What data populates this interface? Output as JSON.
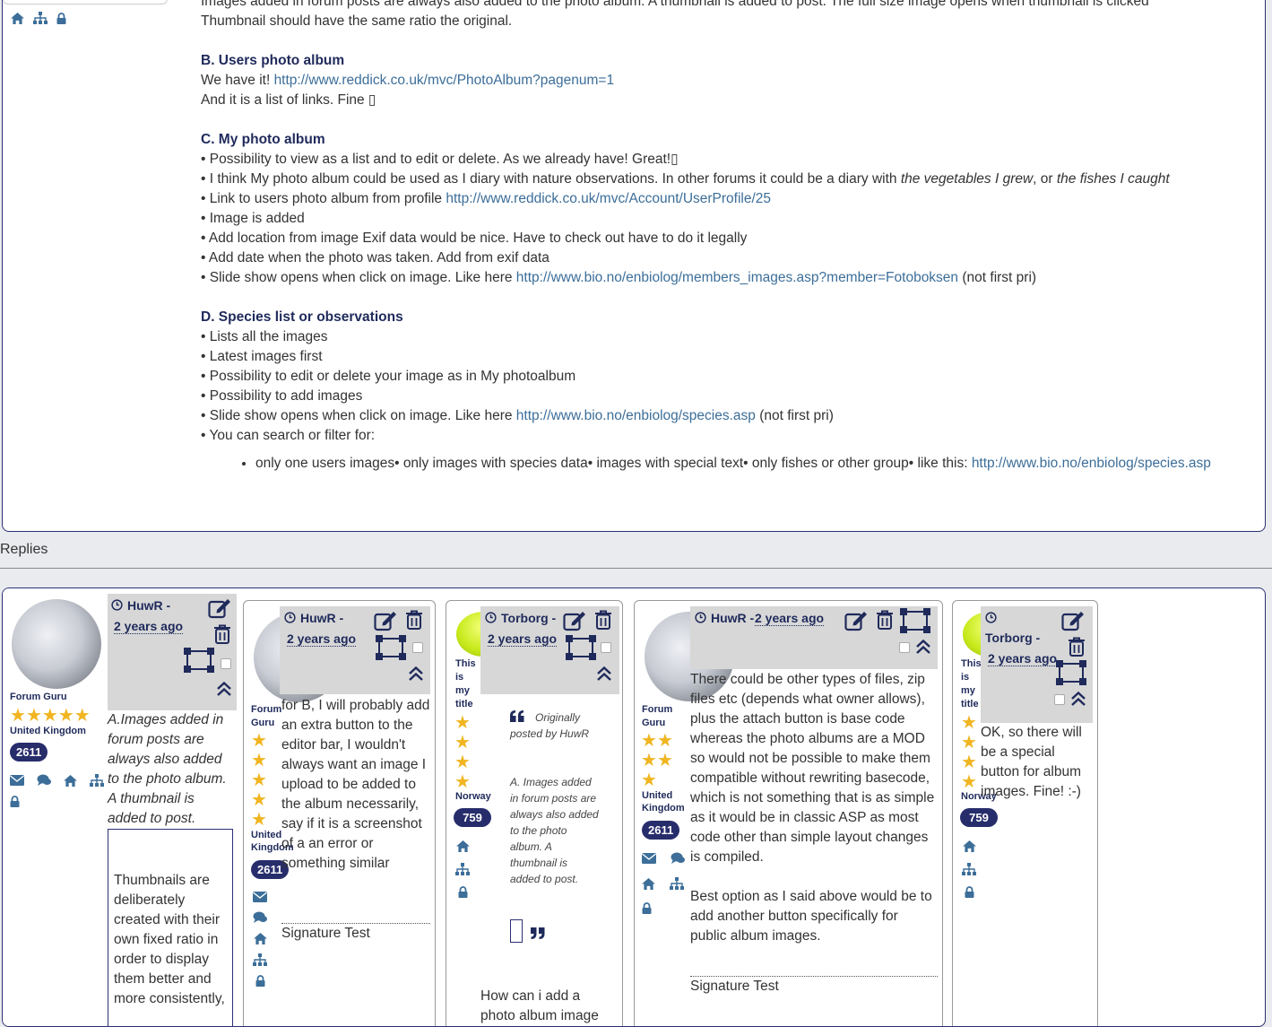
{
  "top_post": {
    "intro_line1": "Images added in forum posts are always also added to the photo album. A thumbnail is added to post. The full size image opens when thumbnail is clicked",
    "intro_line2": "Thumbnail should have the same ratio the original.",
    "section_b": {
      "heading": "B. Users photo album",
      "line1_text": "We have it! ",
      "line1_link": "http://www.reddick.co.uk/mvc/PhotoAlbum?pagenum=1",
      "line2": "And it is a list of links. Fine ▯"
    },
    "section_c": {
      "heading": "C. My photo album",
      "b1": "• Possibility to view as a list and to edit or delete. As we already have! Great!▯",
      "b2_pre": "• I think My photo album could be used as I diary with nature observations. In other forums it could be a diary with ",
      "b2_it1": "the vegetables I grew",
      "b2_mid": ", or ",
      "b2_it2": "the fishes I caught",
      "b3_text": "• Link to users photo album from profile ",
      "b3_link": "http://www.reddick.co.uk/mvc/Account/UserProfile/25",
      "b4": "• Image is added",
      "b5": "• Add location from image Exif data would be nice. Have to check out have to do it legally",
      "b6": "• Add date when the photo was taken. Add from exif data",
      "b7_text": "• Slide show opens when click on image. Like here ",
      "b7_link": "http://www.bio.no/enbiolog/members_images.asp?member=Fotoboksen",
      "b7_after": " (not first pri)"
    },
    "section_d": {
      "heading": "D. Species list or observations",
      "b1": "• Lists all the images",
      "b2": "• Latest images first",
      "b3": "• Possibility to edit or delete your image as in My photoalbum",
      "b4": "• Possibility to add images",
      "b5_text": "• Slide show opens when click on image. Like here ",
      "b5_link": "http://www.bio.no/enbiolog/species.asp",
      "b5_after": " (not first pri)",
      "b6": "• You can search or filter for:",
      "li_text": "only one users images• only images with species data• images with special text• only fishes or other group• like this: ",
      "li_link": "http://www.bio.no/enbiolog/species.asp"
    }
  },
  "replies_label": "Replies",
  "replies": [
    {
      "user": "HuwR -",
      "time": "2 years ago",
      "rank": "Forum Guru",
      "country": "United Kingdom",
      "count": "2611",
      "body_it": "A.Images added in forum posts are always also added to the photo album. A thumbnail is added to post.",
      "quote_text": "Thumbnails are deliberately created with their own fixed ratio in order to display them better and more consistently,"
    },
    {
      "user": "HuwR -",
      "time": "2 years ago",
      "rank": "Forum Guru",
      "country": "United Kingdom",
      "count": "2611",
      "body": "for B, I will probably add an extra button to the editor bar, I wouldn't always want an image I upload to be added to the album necessarily, say if it is a screenshot of a an error or something similar",
      "signature": "Signature Test"
    },
    {
      "user": "Torborg -",
      "time": "2 years ago",
      "rank": "This is my title",
      "country": "Norway",
      "count": "759",
      "quote_by": "Originally posted by HuwR",
      "quote_body": "A.  Images added in forum posts are always also added to the photo album. A thumbnail is added to post.",
      "body": "How can i add a photo album image"
    },
    {
      "user": "HuwR -",
      "time": "2 years ago",
      "rank": "Forum Guru",
      "country": "United Kingdom",
      "count": "2611",
      "body1": "There could be other types of files, zip files etc (depends what owner allows), plus the attach button is base code whereas the photo albums are a MOD so would not be possible to make them compatible without rewriting basecode, which is not something that is as simple as it would be in classic ASP as most code other than simple layout changes is compiled.",
      "body2": "Best option as I said above would be to add another button specifically for public album images.",
      "signature": "Signature Test"
    },
    {
      "user": "Torborg -",
      "time": "2 years ago",
      "rank": "This is my title",
      "country": "Norway",
      "count": "759",
      "body": "OK, so there will be a special button for album images. Fine! :-)"
    }
  ],
  "colors": {
    "navy": "#1f2a5b",
    "link": "#3c6e99",
    "star": "#f0b520",
    "header_bg": "#d7d7d7"
  }
}
